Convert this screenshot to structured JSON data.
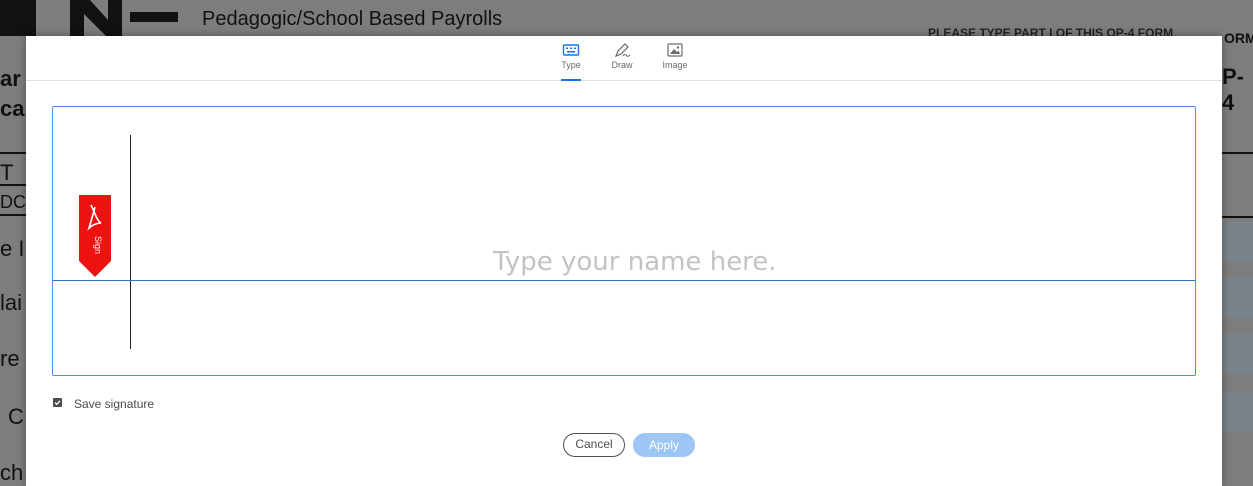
{
  "background_document": {
    "title": "Pedagogic/School Based Payrolls",
    "notice": "PLEASE TYPE PART I OF THIS OP-4 FORM",
    "form_code_fragment": "ORM",
    "form_number_fragment": "P-4",
    "left_fragments": [
      "ar",
      "ca",
      "T",
      "DC",
      "e I",
      "lai",
      "re",
      "C",
      "ch"
    ]
  },
  "signature_dialog": {
    "tabs": [
      {
        "label": "Type",
        "icon": "keyboard-icon",
        "active": true
      },
      {
        "label": "Draw",
        "icon": "pen-icon",
        "active": false
      },
      {
        "label": "Image",
        "icon": "image-icon",
        "active": false
      }
    ],
    "sign_flag": {
      "label": "Sign",
      "icon": "adobe-acrobat-icon"
    },
    "placeholder": "Type your name here.",
    "save_signature": {
      "label": "Save signature",
      "checked": true
    },
    "buttons": {
      "cancel": "Cancel",
      "apply": "Apply"
    }
  },
  "colors": {
    "accent": "#1473e6",
    "apply_disabled": "#9ec6f4",
    "sign_flag": "#ee1111",
    "overlay": "#7d7d7d"
  }
}
